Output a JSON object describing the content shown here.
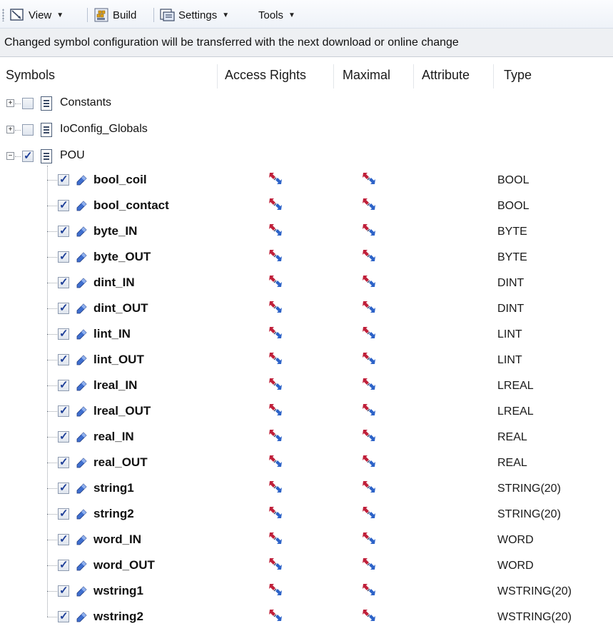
{
  "toolbar": {
    "view_label": "View",
    "build_label": "Build",
    "settings_label": "Settings",
    "tools_label": "Tools"
  },
  "info_message": "Changed symbol configuration will be transferred with the next download or online change",
  "columns": {
    "symbols": "Symbols",
    "access_rights": "Access Rights",
    "maximal": "Maximal",
    "attribute": "Attribute",
    "type": "Type"
  },
  "groups": [
    {
      "label": "Constants",
      "expanded": false,
      "checked": false
    },
    {
      "label": "IoConfig_Globals",
      "expanded": false,
      "checked": false
    },
    {
      "label": "POU",
      "expanded": true,
      "checked": true
    }
  ],
  "variables": [
    {
      "name": "bool_coil",
      "type": "BOOL",
      "checked": true
    },
    {
      "name": "bool_contact",
      "type": "BOOL",
      "checked": true
    },
    {
      "name": "byte_IN",
      "type": "BYTE",
      "checked": true
    },
    {
      "name": "byte_OUT",
      "type": "BYTE",
      "checked": true
    },
    {
      "name": "dint_IN",
      "type": "DINT",
      "checked": true
    },
    {
      "name": "dint_OUT",
      "type": "DINT",
      "checked": true
    },
    {
      "name": "lint_IN",
      "type": "LINT",
      "checked": true
    },
    {
      "name": "lint_OUT",
      "type": "LINT",
      "checked": true
    },
    {
      "name": "lreal_IN",
      "type": "LREAL",
      "checked": true
    },
    {
      "name": "lreal_OUT",
      "type": "LREAL",
      "checked": true
    },
    {
      "name": "real_IN",
      "type": "REAL",
      "checked": true
    },
    {
      "name": "real_OUT",
      "type": "REAL",
      "checked": true
    },
    {
      "name": "string1",
      "type": "STRING(20)",
      "checked": true
    },
    {
      "name": "string2",
      "type": "STRING(20)",
      "checked": true
    },
    {
      "name": "word_IN",
      "type": "WORD",
      "checked": true
    },
    {
      "name": "word_OUT",
      "type": "WORD",
      "checked": true
    },
    {
      "name": "wstring1",
      "type": "WSTRING(20)",
      "checked": true
    },
    {
      "name": "wstring2",
      "type": "WSTRING(20)",
      "checked": true
    }
  ],
  "colors": {
    "access_red": "#c0203a",
    "access_blue": "#2d63c8",
    "var_icon_blue": "#3f6fcf",
    "checkmark": "#1e3f98"
  }
}
